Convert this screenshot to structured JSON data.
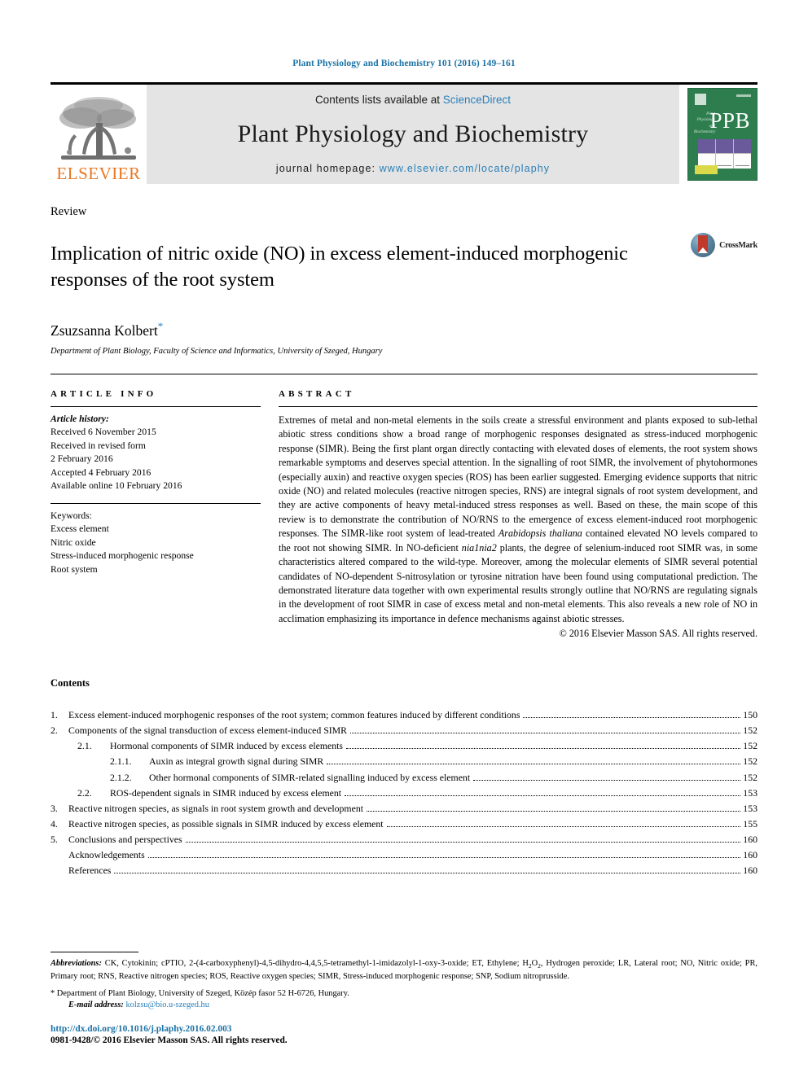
{
  "running_head": "Plant Physiology and Biochemistry 101 (2016) 149–161",
  "masthead": {
    "contents_prefix": "Contents lists available at ",
    "sciencedirect": "ScienceDirect",
    "journal_title": "Plant Physiology and Biochemistry",
    "homepage_prefix": "journal homepage: ",
    "homepage_url": "www.elsevier.com/locate/plaphy",
    "publisher_word": "ELSEVIER",
    "cover_abbrev": "PPB",
    "cover_tagline": "Plant Physiology and Biochemistry"
  },
  "article": {
    "type": "Review",
    "title": "Implication of nitric oxide (NO) in excess element-induced morphogenic responses of the root system",
    "crossmark_label": "CrossMark",
    "author": "Zsuzsanna Kolbert",
    "author_marker": "*",
    "affiliation": "Department of Plant Biology, Faculty of Science and Informatics, University of Szeged, Hungary"
  },
  "info": {
    "heading": "ARTICLE INFO",
    "history_label": "Article history:",
    "history": [
      "Received 6 November 2015",
      "Received in revised form",
      "2 February 2016",
      "Accepted 4 February 2016",
      "Available online 10 February 2016"
    ],
    "keywords_label": "Keywords:",
    "keywords": [
      "Excess element",
      "Nitric oxide",
      "Stress-induced morphogenic response",
      "Root system"
    ]
  },
  "abstract": {
    "heading": "ABSTRACT",
    "paragraph_part1": "Extremes of metal and non-metal elements in the soils create a stressful environment and plants exposed to sub-lethal abiotic stress conditions show a broad range of morphogenic responses designated as stress-induced morphogenic response (SIMR). Being the first plant organ directly contacting with elevated doses of elements, the root system shows remarkable symptoms and deserves special attention. In the signalling of root SIMR, the involvement of phytohormones (especially auxin) and reactive oxygen species (ROS) has been earlier suggested. Emerging evidence supports that nitric oxide (NO) and related molecules (reactive nitrogen species, RNS) are integral signals of root system development, and they are active components of heavy metal-induced stress responses as well. Based on these, the main scope of this review is to demonstrate the contribution of NO/RNS to the emergence of excess element-induced root morphogenic responses. The SIMR-like root system of lead-treated ",
    "italic1": "Arabidopsis thaliana",
    "paragraph_part2": " contained elevated NO levels compared to the root not showing SIMR. In NO-deficient ",
    "italic2": "nia1nia2",
    "paragraph_part3": " plants, the degree of selenium-induced root SIMR was, in some characteristics altered compared to the wild-type. Moreover, among the molecular elements of SIMR several potential candidates of NO-dependent S-nitrosylation or tyrosine nitration have been found using computational prediction. The demonstrated literature data together with own experimental results strongly outline that NO/RNS are regulating signals in the development of root SIMR in case of excess metal and non-metal elements. This also reveals a new role of NO in acclimation emphasizing its importance in defence mechanisms against abiotic stresses.",
    "copyright": "© 2016 Elsevier Masson SAS. All rights reserved."
  },
  "contents": {
    "title": "Contents",
    "entries": [
      {
        "level": 1,
        "num": "1.",
        "label": "Excess element-induced morphogenic responses of the root system; common features induced by different conditions",
        "page": "150"
      },
      {
        "level": 1,
        "num": "2.",
        "label": "Components of the signal transduction of excess element-induced SIMR",
        "page": "152"
      },
      {
        "level": 2,
        "num": "2.1.",
        "label": "Hormonal components of SIMR induced by excess elements",
        "page": "152"
      },
      {
        "level": 3,
        "num": "2.1.1.",
        "label": "Auxin as integral growth signal during SIMR",
        "page": "152"
      },
      {
        "level": 3,
        "num": "2.1.2.",
        "label": "Other hormonal components of SIMR-related signalling induced by excess element",
        "page": "152"
      },
      {
        "level": 2,
        "num": "2.2.",
        "label": "ROS-dependent signals in SIMR induced by excess element",
        "page": "153"
      },
      {
        "level": 1,
        "num": "3.",
        "label": "Reactive nitrogen species, as signals in root system growth and development",
        "page": "153"
      },
      {
        "level": 1,
        "num": "4.",
        "label": "Reactive nitrogen species, as possible signals in SIMR induced by excess element",
        "page": "155"
      },
      {
        "level": 1,
        "num": "5.",
        "label": "Conclusions and perspectives",
        "page": "160"
      },
      {
        "level": 0,
        "num": "",
        "label": "Acknowledgements",
        "page": "160"
      },
      {
        "level": 0,
        "num": "",
        "label": "References",
        "page": "160"
      }
    ]
  },
  "footnotes": {
    "abbrev_label": "Abbreviations:",
    "abbrev_text_a": " CK, Cytokinin; cPTIO, 2-(4-carboxyphenyl)-4,5-dihydro-4,4,5,5-tetramethyl-1-imidazolyl-1-oxy-3-oxide; ET, Ethylene; H",
    "abbrev_sub1": "2",
    "abbrev_text_b": "O",
    "abbrev_sub2": "2",
    "abbrev_text_c": ", Hydrogen peroxide; LR, Lateral root; NO, Nitric oxide; PR, Primary root; RNS, Reactive nitrogen species; ROS, Reactive oxygen species; SIMR, Stress-induced morphogenic response; SNP, Sodium nitroprusside.",
    "corresponding": "* Department of Plant Biology, University of Szeged, Közép fasor 52 H-6726, Hungary.",
    "email_label": "E-mail address:",
    "email": "kolzsu@bio.u-szeged.hu",
    "doi": "http://dx.doi.org/10.1016/j.plaphy.2016.02.003",
    "issn": "0981-9428/© 2016 Elsevier Masson SAS. All rights reserved."
  },
  "colors": {
    "link_teal": "#2a7fb8",
    "running_head": "#1b72a6",
    "elsevier_orange": "#E87722",
    "masthead_grey": "#e4e4e4",
    "cover_green": "#2e7d4f"
  }
}
